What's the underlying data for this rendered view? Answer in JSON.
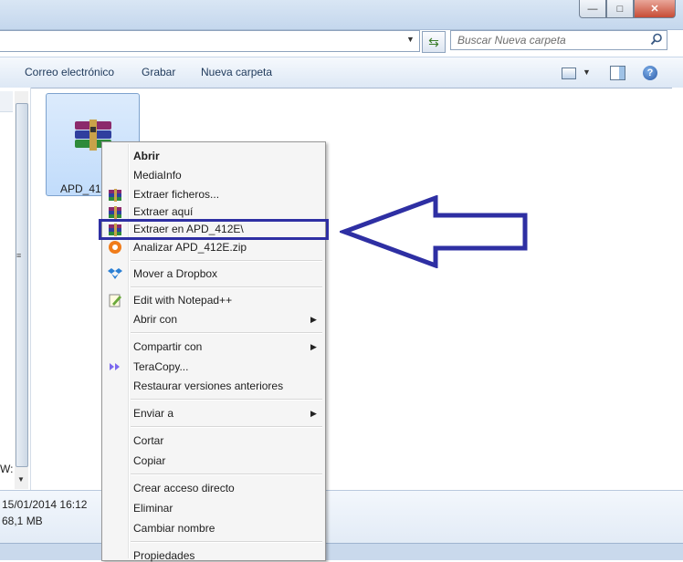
{
  "search": {
    "placeholder": "Buscar Nueva carpeta"
  },
  "toolbar": {
    "email_label": "Correo electrónico",
    "burn_label": "Grabar",
    "new_folder_label": "Nueva carpeta"
  },
  "nav": {
    "fragment": "W:"
  },
  "file": {
    "label": "APD_412"
  },
  "details": {
    "date": "15/01/2014 16:12",
    "size": "68,1 MB"
  },
  "context_menu": {
    "items": [
      {
        "label": "Abrir",
        "icon": "none"
      },
      {
        "label": "MediaInfo",
        "icon": "none"
      },
      {
        "label": "Extraer ficheros...",
        "icon": "winrar-icon"
      },
      {
        "label": "Extraer aquí",
        "icon": "winrar-icon"
      },
      {
        "label": "Extraer en APD_412E\\",
        "icon": "winrar-icon"
      },
      {
        "label": "Analizar APD_412E.zip",
        "icon": "avast-icon"
      },
      {
        "label": "Mover a Dropbox",
        "icon": "dropbox-icon"
      },
      {
        "label": "Edit with Notepad++",
        "icon": "notepadpp-icon"
      },
      {
        "label": "Abrir con",
        "icon": "none"
      },
      {
        "label": "Compartir con",
        "icon": "none"
      },
      {
        "label": "TeraCopy...",
        "icon": "teracopy-icon"
      },
      {
        "label": "Restaurar versiones anteriores",
        "icon": "none"
      },
      {
        "label": "Enviar a",
        "icon": "none"
      },
      {
        "label": "Cortar",
        "icon": "none"
      },
      {
        "label": "Copiar",
        "icon": "none"
      },
      {
        "label": "Crear acceso directo",
        "icon": "none"
      },
      {
        "label": "Eliminar",
        "icon": "none"
      },
      {
        "label": "Cambiar nombre",
        "icon": "none"
      },
      {
        "label": "Propiedades",
        "icon": "none"
      }
    ]
  },
  "colors": {
    "annotation": "#2e2fa3",
    "selection": "#c1dcfb"
  }
}
